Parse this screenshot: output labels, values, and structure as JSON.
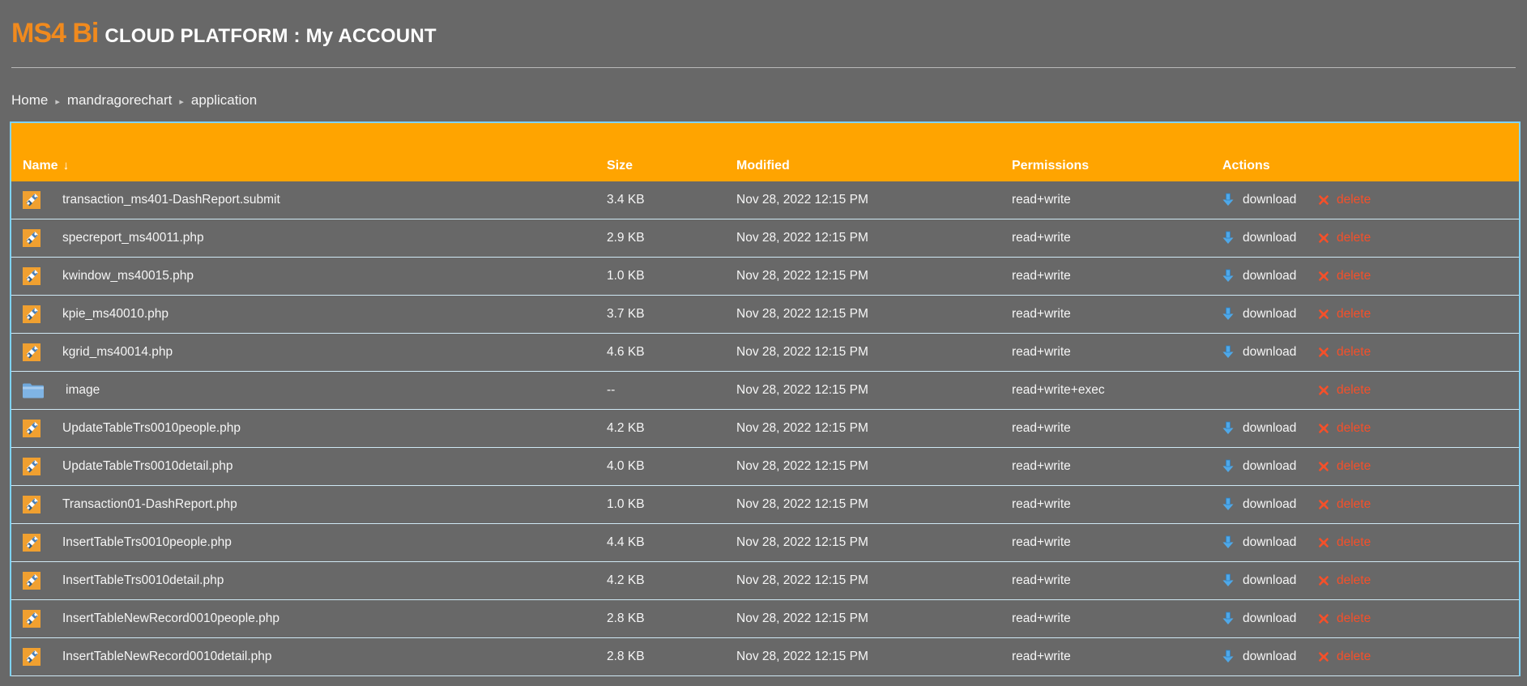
{
  "header": {
    "logo": "MS4 Bi",
    "title": "CLOUD PLATFORM : My ACCOUNT"
  },
  "breadcrumb": {
    "separator": "▸",
    "items": [
      {
        "label": "Home"
      },
      {
        "label": "mandragorechart"
      },
      {
        "label": "application"
      }
    ]
  },
  "colors": {
    "page_background": "#686868",
    "table_header": "#FFA400",
    "table_border": "#7FD3F7",
    "brand_orange": "#F08A1E",
    "delete_red": "#F4502A",
    "download_blue": "#4FA8E8"
  },
  "table": {
    "columns": [
      {
        "key": "name",
        "label": "Name",
        "sort_indicator": "↓"
      },
      {
        "key": "size",
        "label": "Size"
      },
      {
        "key": "modified",
        "label": "Modified"
      },
      {
        "key": "permissions",
        "label": "Permissions"
      },
      {
        "key": "actions",
        "label": "Actions"
      }
    ],
    "actions": {
      "download_label": "download",
      "download_icon": "download-arrow-icon",
      "delete_label": "delete",
      "delete_icon": "red-x-icon"
    },
    "rows": [
      {
        "icon": "php-file-icon",
        "type": "file",
        "name": "transaction_ms401-DashReport.submit",
        "size": "3.4 KB",
        "modified": "Nov 28, 2022 12:15 PM",
        "permissions": "read+write",
        "has_download": true,
        "has_delete": true
      },
      {
        "icon": "php-file-icon",
        "type": "file",
        "name": "specreport_ms40011.php",
        "size": "2.9 KB",
        "modified": "Nov 28, 2022 12:15 PM",
        "permissions": "read+write",
        "has_download": true,
        "has_delete": true
      },
      {
        "icon": "php-file-icon",
        "type": "file",
        "name": "kwindow_ms40015.php",
        "size": "1.0 KB",
        "modified": "Nov 28, 2022 12:15 PM",
        "permissions": "read+write",
        "has_download": true,
        "has_delete": true
      },
      {
        "icon": "php-file-icon",
        "type": "file",
        "name": "kpie_ms40010.php",
        "size": "3.7 KB",
        "modified": "Nov 28, 2022 12:15 PM",
        "permissions": "read+write",
        "has_download": true,
        "has_delete": true
      },
      {
        "icon": "php-file-icon",
        "type": "file",
        "name": "kgrid_ms40014.php",
        "size": "4.6 KB",
        "modified": "Nov 28, 2022 12:15 PM",
        "permissions": "read+write",
        "has_download": true,
        "has_delete": true
      },
      {
        "icon": "folder-icon",
        "type": "folder",
        "name": "image",
        "size": "--",
        "modified": "Nov 28, 2022 12:15 PM",
        "permissions": "read+write+exec",
        "has_download": false,
        "has_delete": true
      },
      {
        "icon": "php-file-icon",
        "type": "file",
        "name": "UpdateTableTrs0010people.php",
        "size": "4.2 KB",
        "modified": "Nov 28, 2022 12:15 PM",
        "permissions": "read+write",
        "has_download": true,
        "has_delete": true
      },
      {
        "icon": "php-file-icon",
        "type": "file",
        "name": "UpdateTableTrs0010detail.php",
        "size": "4.0 KB",
        "modified": "Nov 28, 2022 12:15 PM",
        "permissions": "read+write",
        "has_download": true,
        "has_delete": true
      },
      {
        "icon": "php-file-icon",
        "type": "file",
        "name": "Transaction01-DashReport.php",
        "size": "1.0 KB",
        "modified": "Nov 28, 2022 12:15 PM",
        "permissions": "read+write",
        "has_download": true,
        "has_delete": true
      },
      {
        "icon": "php-file-icon",
        "type": "file",
        "name": "InsertTableTrs0010people.php",
        "size": "4.4 KB",
        "modified": "Nov 28, 2022 12:15 PM",
        "permissions": "read+write",
        "has_download": true,
        "has_delete": true
      },
      {
        "icon": "php-file-icon",
        "type": "file",
        "name": "InsertTableTrs0010detail.php",
        "size": "4.2 KB",
        "modified": "Nov 28, 2022 12:15 PM",
        "permissions": "read+write",
        "has_download": true,
        "has_delete": true
      },
      {
        "icon": "php-file-icon",
        "type": "file",
        "name": "InsertTableNewRecord0010people.php",
        "size": "2.8 KB",
        "modified": "Nov 28, 2022 12:15 PM",
        "permissions": "read+write",
        "has_download": true,
        "has_delete": true
      },
      {
        "icon": "php-file-icon",
        "type": "file",
        "name": "InsertTableNewRecord0010detail.php",
        "size": "2.8 KB",
        "modified": "Nov 28, 2022 12:15 PM",
        "permissions": "read+write",
        "has_download": true,
        "has_delete": true
      }
    ]
  }
}
